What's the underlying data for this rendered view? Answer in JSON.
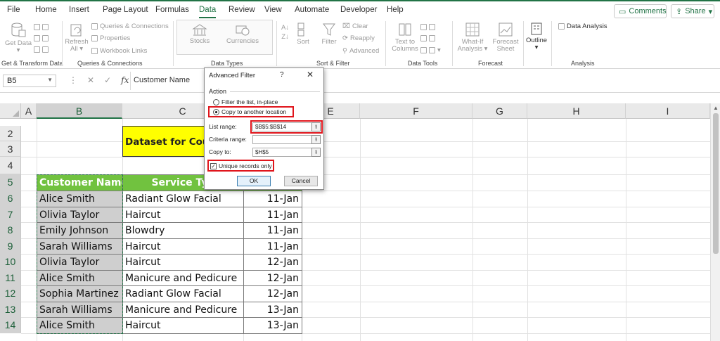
{
  "ribbon_tabs": [
    "File",
    "Home",
    "Insert",
    "Page Layout",
    "Formulas",
    "Data",
    "Review",
    "View",
    "Automate",
    "Developer",
    "Help"
  ],
  "active_tab": "Data",
  "top_buttons": {
    "comments": "Comments",
    "share": "Share"
  },
  "ribbon": {
    "get_data": "Get Data",
    "queries_connections": "Queries & Connections",
    "properties": "Properties",
    "workbook_links": "Workbook Links",
    "refresh_all": "Refresh All",
    "stocks": "Stocks",
    "currencies": "Currencies",
    "sort": "Sort",
    "filter": "Filter",
    "clear": "Clear",
    "reapply": "Reapply",
    "advanced": "Advanced",
    "text_to_columns": "Text to Columns",
    "what_if": "What-If Analysis",
    "forecast_sheet": "Forecast Sheet",
    "outline": "Outline",
    "data_analysis": "Data Analysis",
    "groups": {
      "get_transform": "Get & Transform Data",
      "queries": "Queries & Connections",
      "data_types": "Data Types",
      "sort_filter": "Sort & Filter",
      "data_tools": "Data Tools",
      "forecast": "Forecast",
      "analysis": "Analysis"
    }
  },
  "formula_bar": {
    "cell_ref": "B5",
    "value": "Customer Name"
  },
  "columns": [
    "A",
    "B",
    "C",
    "D",
    "E",
    "F",
    "G",
    "H",
    "I"
  ],
  "rows": [
    "2",
    "3",
    "4",
    "5",
    "6",
    "7",
    "8",
    "9",
    "10",
    "11",
    "12",
    "13",
    "14"
  ],
  "sheet": {
    "title": "Dataset for Cou",
    "headers": {
      "customer": "Customer Name",
      "service": "Service Typ"
    },
    "records": [
      {
        "name": "Alice Smith",
        "service": "Radiant Glow Facial",
        "date": "11-Jan"
      },
      {
        "name": "Olivia Taylor",
        "service": "Haircut",
        "date": "11-Jan"
      },
      {
        "name": "Emily Johnson",
        "service": "Blowdry",
        "date": "11-Jan"
      },
      {
        "name": "Sarah Williams",
        "service": "Haircut",
        "date": "11-Jan"
      },
      {
        "name": "Olivia Taylor",
        "service": "Haircut",
        "date": "12-Jan"
      },
      {
        "name": "Alice Smith",
        "service": "Manicure and Pedicure",
        "date": "12-Jan"
      },
      {
        "name": "Sophia Martinez",
        "service": "Radiant Glow Facial",
        "date": "12-Jan"
      },
      {
        "name": "Sarah Williams",
        "service": "Manicure and Pedicure",
        "date": "13-Jan"
      },
      {
        "name": "Alice Smith",
        "service": "Haircut",
        "date": "13-Jan"
      }
    ]
  },
  "dialog": {
    "title": "Advanced Filter",
    "help": "?",
    "close": "✕",
    "action_label": "Action",
    "option_filter_in_place": "Filter the list, in-place",
    "option_copy": "Copy to another location",
    "list_range_label": "List range:",
    "list_range_value": "$B$5:$B$14",
    "criteria_range_label": "Criteria range:",
    "criteria_range_value": "",
    "copy_to_label": "Copy to:",
    "copy_to_value": "$H$5",
    "unique_records_label": "Unique records only",
    "ok": "OK",
    "cancel": "Cancel"
  },
  "colors": {
    "excel_green": "#217346",
    "header_green": "#71c23f",
    "title_yellow": "#ffff00",
    "highlight_red": "#e0151c"
  }
}
